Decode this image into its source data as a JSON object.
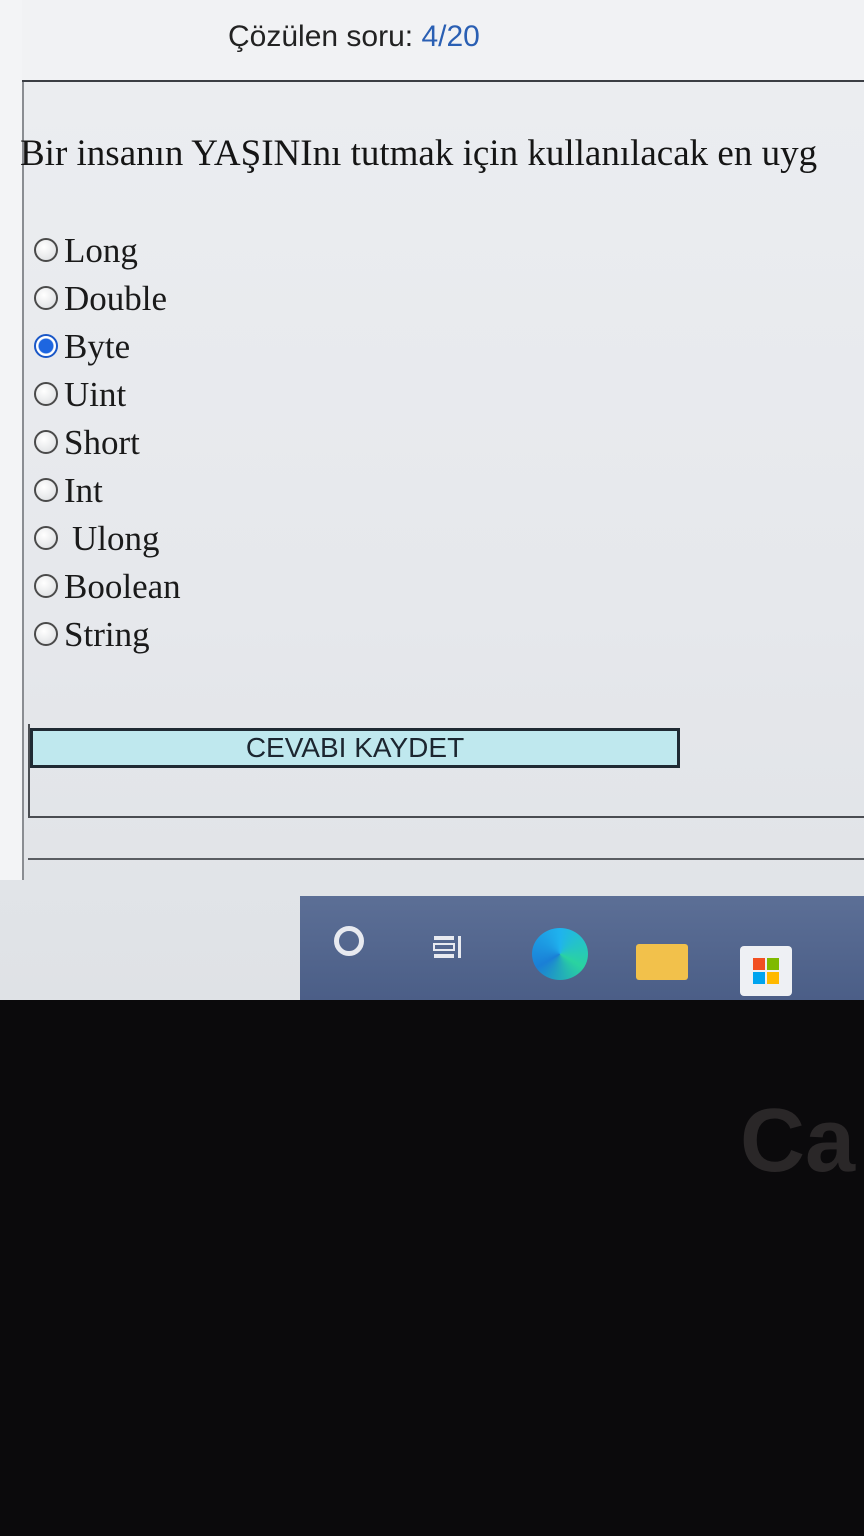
{
  "header": {
    "progress_label": "Çözülen soru:",
    "progress_count": "4/20"
  },
  "question": {
    "text": "Bir insanın YAŞINInı tutmak için kullanılacak en uyg"
  },
  "options": [
    {
      "label": "Long",
      "selected": false
    },
    {
      "label": "Double",
      "selected": false
    },
    {
      "label": "Byte",
      "selected": true
    },
    {
      "label": "Uint",
      "selected": false
    },
    {
      "label": "Short",
      "selected": false
    },
    {
      "label": "Int",
      "selected": false
    },
    {
      "label": "Ulong",
      "selected": false
    },
    {
      "label": "Boolean",
      "selected": false
    },
    {
      "label": "String",
      "selected": false
    }
  ],
  "submit": {
    "label": "CEVABI KAYDET"
  },
  "taskbar": {
    "icons": [
      "search-icon",
      "task-view-icon",
      "edge-icon",
      "file-explorer-icon",
      "store-icon"
    ]
  },
  "background_text": "Ca",
  "colors": {
    "accent_blue": "#2a5fb3",
    "button_fill": "#bfe8ee",
    "taskbar": "#4a5d86"
  }
}
